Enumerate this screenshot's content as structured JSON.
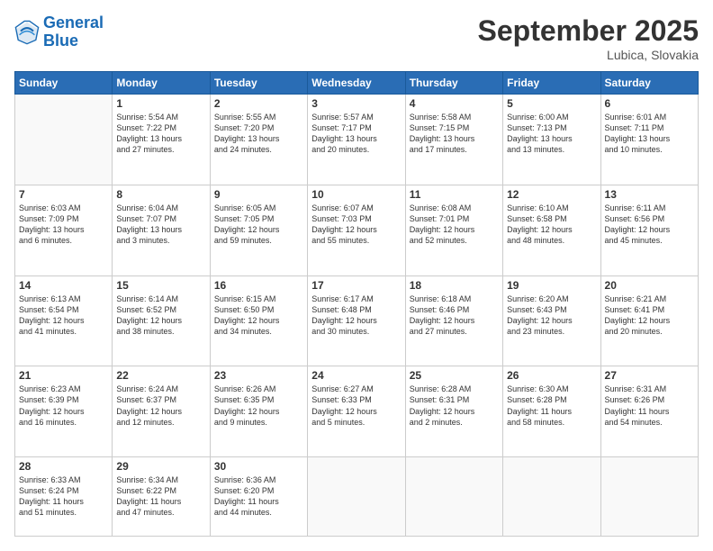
{
  "header": {
    "logo_general": "General",
    "logo_blue": "Blue",
    "month_title": "September 2025",
    "location": "Lubica, Slovakia"
  },
  "weekdays": [
    "Sunday",
    "Monday",
    "Tuesday",
    "Wednesday",
    "Thursday",
    "Friday",
    "Saturday"
  ],
  "weeks": [
    [
      {
        "day": "",
        "info": ""
      },
      {
        "day": "1",
        "info": "Sunrise: 5:54 AM\nSunset: 7:22 PM\nDaylight: 13 hours\nand 27 minutes."
      },
      {
        "day": "2",
        "info": "Sunrise: 5:55 AM\nSunset: 7:20 PM\nDaylight: 13 hours\nand 24 minutes."
      },
      {
        "day": "3",
        "info": "Sunrise: 5:57 AM\nSunset: 7:17 PM\nDaylight: 13 hours\nand 20 minutes."
      },
      {
        "day": "4",
        "info": "Sunrise: 5:58 AM\nSunset: 7:15 PM\nDaylight: 13 hours\nand 17 minutes."
      },
      {
        "day": "5",
        "info": "Sunrise: 6:00 AM\nSunset: 7:13 PM\nDaylight: 13 hours\nand 13 minutes."
      },
      {
        "day": "6",
        "info": "Sunrise: 6:01 AM\nSunset: 7:11 PM\nDaylight: 13 hours\nand 10 minutes."
      }
    ],
    [
      {
        "day": "7",
        "info": "Sunrise: 6:03 AM\nSunset: 7:09 PM\nDaylight: 13 hours\nand 6 minutes."
      },
      {
        "day": "8",
        "info": "Sunrise: 6:04 AM\nSunset: 7:07 PM\nDaylight: 13 hours\nand 3 minutes."
      },
      {
        "day": "9",
        "info": "Sunrise: 6:05 AM\nSunset: 7:05 PM\nDaylight: 12 hours\nand 59 minutes."
      },
      {
        "day": "10",
        "info": "Sunrise: 6:07 AM\nSunset: 7:03 PM\nDaylight: 12 hours\nand 55 minutes."
      },
      {
        "day": "11",
        "info": "Sunrise: 6:08 AM\nSunset: 7:01 PM\nDaylight: 12 hours\nand 52 minutes."
      },
      {
        "day": "12",
        "info": "Sunrise: 6:10 AM\nSunset: 6:58 PM\nDaylight: 12 hours\nand 48 minutes."
      },
      {
        "day": "13",
        "info": "Sunrise: 6:11 AM\nSunset: 6:56 PM\nDaylight: 12 hours\nand 45 minutes."
      }
    ],
    [
      {
        "day": "14",
        "info": "Sunrise: 6:13 AM\nSunset: 6:54 PM\nDaylight: 12 hours\nand 41 minutes."
      },
      {
        "day": "15",
        "info": "Sunrise: 6:14 AM\nSunset: 6:52 PM\nDaylight: 12 hours\nand 38 minutes."
      },
      {
        "day": "16",
        "info": "Sunrise: 6:15 AM\nSunset: 6:50 PM\nDaylight: 12 hours\nand 34 minutes."
      },
      {
        "day": "17",
        "info": "Sunrise: 6:17 AM\nSunset: 6:48 PM\nDaylight: 12 hours\nand 30 minutes."
      },
      {
        "day": "18",
        "info": "Sunrise: 6:18 AM\nSunset: 6:46 PM\nDaylight: 12 hours\nand 27 minutes."
      },
      {
        "day": "19",
        "info": "Sunrise: 6:20 AM\nSunset: 6:43 PM\nDaylight: 12 hours\nand 23 minutes."
      },
      {
        "day": "20",
        "info": "Sunrise: 6:21 AM\nSunset: 6:41 PM\nDaylight: 12 hours\nand 20 minutes."
      }
    ],
    [
      {
        "day": "21",
        "info": "Sunrise: 6:23 AM\nSunset: 6:39 PM\nDaylight: 12 hours\nand 16 minutes."
      },
      {
        "day": "22",
        "info": "Sunrise: 6:24 AM\nSunset: 6:37 PM\nDaylight: 12 hours\nand 12 minutes."
      },
      {
        "day": "23",
        "info": "Sunrise: 6:26 AM\nSunset: 6:35 PM\nDaylight: 12 hours\nand 9 minutes."
      },
      {
        "day": "24",
        "info": "Sunrise: 6:27 AM\nSunset: 6:33 PM\nDaylight: 12 hours\nand 5 minutes."
      },
      {
        "day": "25",
        "info": "Sunrise: 6:28 AM\nSunset: 6:31 PM\nDaylight: 12 hours\nand 2 minutes."
      },
      {
        "day": "26",
        "info": "Sunrise: 6:30 AM\nSunset: 6:28 PM\nDaylight: 11 hours\nand 58 minutes."
      },
      {
        "day": "27",
        "info": "Sunrise: 6:31 AM\nSunset: 6:26 PM\nDaylight: 11 hours\nand 54 minutes."
      }
    ],
    [
      {
        "day": "28",
        "info": "Sunrise: 6:33 AM\nSunset: 6:24 PM\nDaylight: 11 hours\nand 51 minutes."
      },
      {
        "day": "29",
        "info": "Sunrise: 6:34 AM\nSunset: 6:22 PM\nDaylight: 11 hours\nand 47 minutes."
      },
      {
        "day": "30",
        "info": "Sunrise: 6:36 AM\nSunset: 6:20 PM\nDaylight: 11 hours\nand 44 minutes."
      },
      {
        "day": "",
        "info": ""
      },
      {
        "day": "",
        "info": ""
      },
      {
        "day": "",
        "info": ""
      },
      {
        "day": "",
        "info": ""
      }
    ]
  ]
}
